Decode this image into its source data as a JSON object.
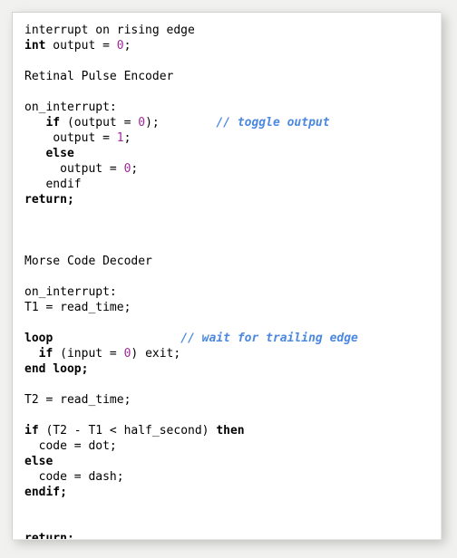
{
  "panel": {
    "name": "code-listing-panel",
    "background_color": "#ffffff",
    "page_background_color": "#f1f1ef",
    "border_color": "#d2d2d0"
  },
  "theme": {
    "text_color": "#000000",
    "number_literal_color": "#a0289c",
    "comment_color": "#4b88e0",
    "keyword_weight": "bold"
  },
  "code": {
    "language": "pseudocode",
    "lines": [
      {
        "id": "l01",
        "indent": 0,
        "tokens": [
          {
            "t": "plain",
            "v": "interrupt on rising edge"
          }
        ]
      },
      {
        "id": "l02",
        "indent": 0,
        "tokens": [
          {
            "t": "kw",
            "v": "int"
          },
          {
            "t": "plain",
            "v": " output = "
          },
          {
            "t": "num",
            "v": "0"
          },
          {
            "t": "plain",
            "v": ";"
          }
        ]
      },
      {
        "id": "l03",
        "indent": 0,
        "tokens": []
      },
      {
        "id": "l04",
        "indent": 0,
        "tokens": [
          {
            "t": "hdr",
            "v": "Retinal Pulse Encoder"
          }
        ]
      },
      {
        "id": "l05",
        "indent": 0,
        "tokens": []
      },
      {
        "id": "l06",
        "indent": 0,
        "tokens": [
          {
            "t": "plain",
            "v": "on_interrupt:"
          }
        ]
      },
      {
        "id": "l07",
        "indent": 3,
        "tokens": [
          {
            "t": "kw",
            "v": "if"
          },
          {
            "t": "plain",
            "v": " (output = "
          },
          {
            "t": "num",
            "v": "0"
          },
          {
            "t": "plain",
            "v": ");"
          },
          {
            "t": "plain",
            "v": "        "
          },
          {
            "t": "cmt",
            "v": "// toggle output"
          }
        ]
      },
      {
        "id": "l08",
        "indent": 4,
        "tokens": [
          {
            "t": "plain",
            "v": "output = "
          },
          {
            "t": "num",
            "v": "1"
          },
          {
            "t": "plain",
            "v": ";"
          }
        ]
      },
      {
        "id": "l09",
        "indent": 3,
        "tokens": [
          {
            "t": "kw",
            "v": "else"
          }
        ]
      },
      {
        "id": "l10",
        "indent": 5,
        "tokens": [
          {
            "t": "plain",
            "v": "output = "
          },
          {
            "t": "num",
            "v": "0"
          },
          {
            "t": "plain",
            "v": ";"
          }
        ]
      },
      {
        "id": "l11",
        "indent": 3,
        "tokens": [
          {
            "t": "plain",
            "v": "endif"
          }
        ]
      },
      {
        "id": "l12",
        "indent": 0,
        "tokens": [
          {
            "t": "kw",
            "v": "return;"
          }
        ]
      },
      {
        "id": "l13",
        "indent": 0,
        "tokens": []
      },
      {
        "id": "l14",
        "indent": 0,
        "tokens": []
      },
      {
        "id": "l15",
        "indent": 0,
        "tokens": []
      },
      {
        "id": "l16",
        "indent": 0,
        "tokens": [
          {
            "t": "hdr",
            "v": "Morse Code Decoder"
          }
        ]
      },
      {
        "id": "l17",
        "indent": 0,
        "tokens": []
      },
      {
        "id": "l18",
        "indent": 0,
        "tokens": [
          {
            "t": "plain",
            "v": "on_interrupt:"
          }
        ]
      },
      {
        "id": "l19",
        "indent": 0,
        "tokens": [
          {
            "t": "plain",
            "v": "T1 = read_time;"
          }
        ]
      },
      {
        "id": "l20",
        "indent": 0,
        "tokens": []
      },
      {
        "id": "l21",
        "indent": 0,
        "tokens": [
          {
            "t": "kw",
            "v": "loop"
          },
          {
            "t": "plain",
            "v": "                  "
          },
          {
            "t": "cmt",
            "v": "// wait for trailing edge"
          }
        ]
      },
      {
        "id": "l22",
        "indent": 2,
        "tokens": [
          {
            "t": "kw",
            "v": "if"
          },
          {
            "t": "plain",
            "v": " (input = "
          },
          {
            "t": "num",
            "v": "0"
          },
          {
            "t": "plain",
            "v": ") exit;"
          }
        ]
      },
      {
        "id": "l23",
        "indent": 0,
        "tokens": [
          {
            "t": "kw",
            "v": "end loop;"
          }
        ]
      },
      {
        "id": "l24",
        "indent": 0,
        "tokens": []
      },
      {
        "id": "l25",
        "indent": 0,
        "tokens": [
          {
            "t": "plain",
            "v": "T2 = read_time;"
          }
        ]
      },
      {
        "id": "l26",
        "indent": 0,
        "tokens": []
      },
      {
        "id": "l27",
        "indent": 0,
        "tokens": [
          {
            "t": "kw",
            "v": "if"
          },
          {
            "t": "plain",
            "v": " (T2 - T1 < half_second) "
          },
          {
            "t": "kw",
            "v": "then"
          }
        ]
      },
      {
        "id": "l28",
        "indent": 2,
        "tokens": [
          {
            "t": "plain",
            "v": "code = dot;"
          }
        ]
      },
      {
        "id": "l29",
        "indent": 0,
        "tokens": [
          {
            "t": "kw",
            "v": "else"
          }
        ]
      },
      {
        "id": "l30",
        "indent": 2,
        "tokens": [
          {
            "t": "plain",
            "v": "code = dash;"
          }
        ]
      },
      {
        "id": "l31",
        "indent": 0,
        "tokens": [
          {
            "t": "kw",
            "v": "endif;"
          }
        ]
      },
      {
        "id": "l32",
        "indent": 0,
        "tokens": []
      },
      {
        "id": "l33",
        "indent": 0,
        "tokens": []
      },
      {
        "id": "l34",
        "indent": 0,
        "tokens": [
          {
            "t": "kw",
            "v": "return;"
          }
        ]
      }
    ]
  }
}
